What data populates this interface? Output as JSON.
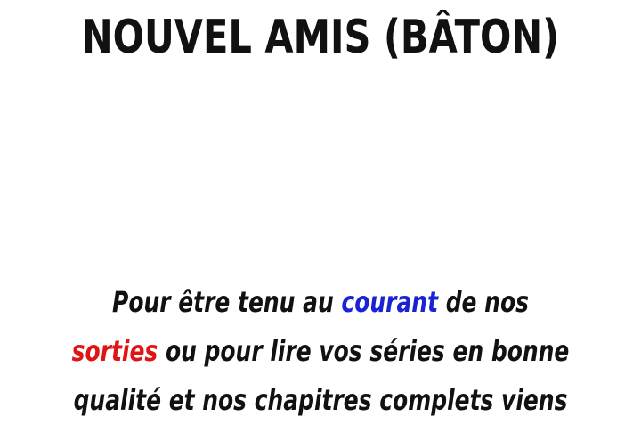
{
  "title": "NOUVEL AMIS (BÂTON)",
  "message": {
    "line1": {
      "before": "Pour être tenu au ",
      "highlight": "courant",
      "after": " de nos"
    },
    "line2": {
      "highlight": "sorties",
      "after": " ou pour lire vos séries en bonne"
    },
    "line3": {
      "text": "qualité et nos chapitres complets viens"
    }
  },
  "colors": {
    "highlight_blue": "#1a22d6",
    "highlight_red": "#e01414",
    "text": "#111111",
    "background": "#ffffff"
  }
}
